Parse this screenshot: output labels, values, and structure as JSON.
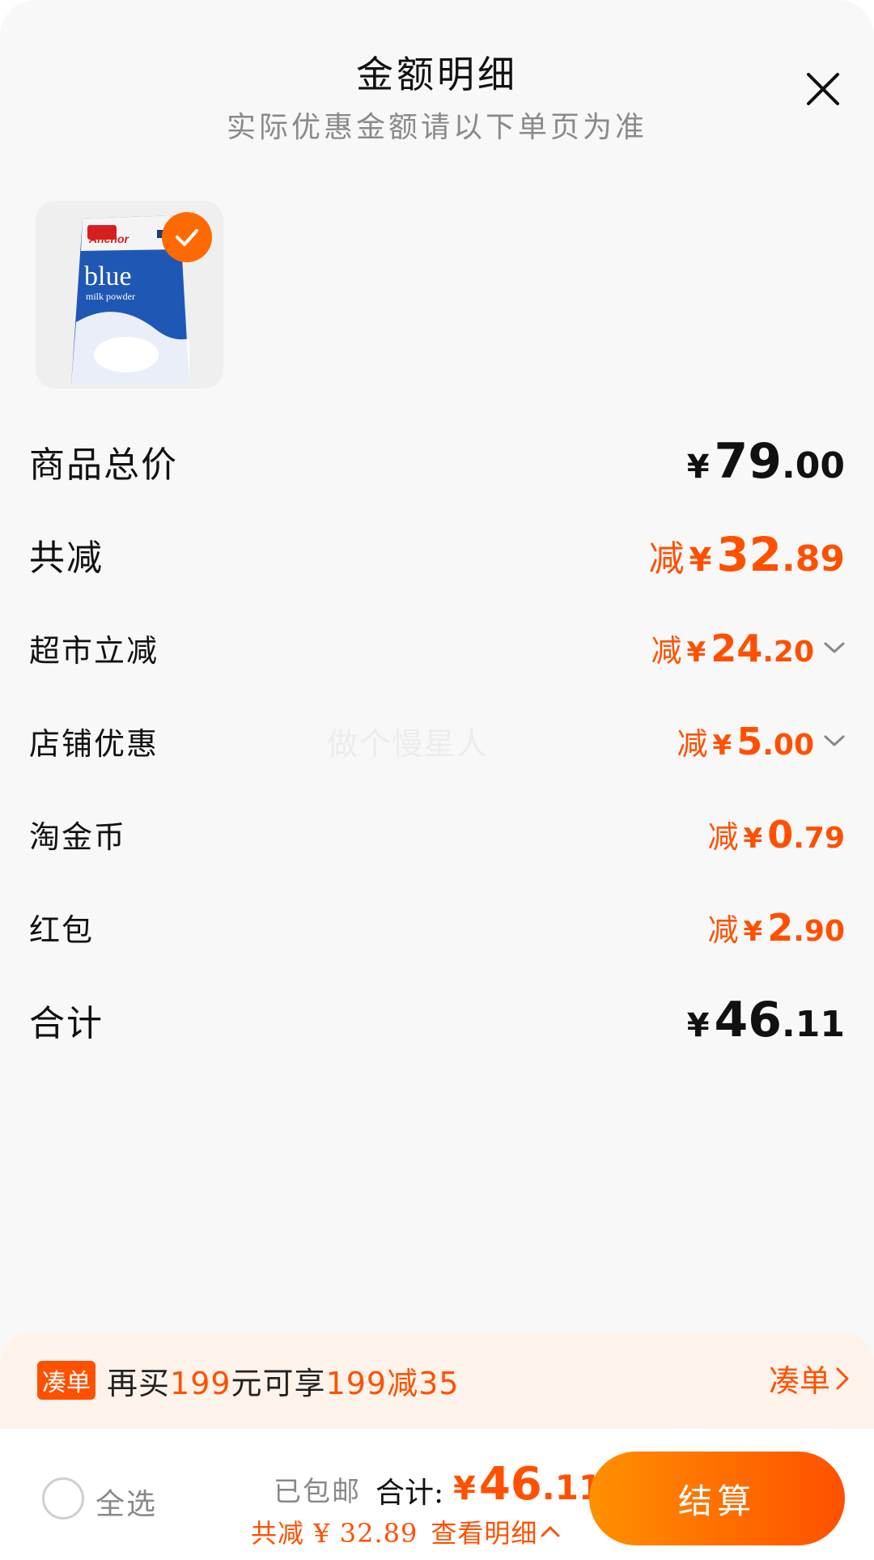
{
  "header": {
    "title": "金额明细",
    "subtitle": "实际优惠金额请以下单页为准",
    "close_icon": "close-icon"
  },
  "product": {
    "image_icon": "anchor-blue-milk-powder-package",
    "brand": "Anchor",
    "name": "blue",
    "desc": "milk powder",
    "selected": true
  },
  "rows": {
    "total_price": {
      "label": "商品总价",
      "yen": "¥",
      "int": "79",
      "dec": ".00"
    },
    "total_discount": {
      "label": "共减",
      "prefix": "减",
      "yen": "¥",
      "int": "32",
      "dec": ".89"
    },
    "supermarket": {
      "label": "超市立减",
      "prefix": "减",
      "yen": "¥",
      "int": "24",
      "dec": ".20"
    },
    "store": {
      "label": "店铺优惠",
      "prefix": "减",
      "yen": "¥",
      "int": "5",
      "dec": ".00"
    },
    "coins": {
      "label": "淘金币",
      "prefix": "减",
      "yen": "¥",
      "int": "0",
      "dec": ".79"
    },
    "redpacket": {
      "label": "红包",
      "prefix": "减",
      "yen": "¥",
      "int": "2",
      "dec": ".90"
    },
    "sum": {
      "label": "合计",
      "yen": "¥",
      "int": "46",
      "dec": ".11"
    }
  },
  "watermark": "做个慢星人",
  "promo": {
    "tag": "凑单",
    "text_a": "再买",
    "amount_a": "199",
    "text_b": "元可享",
    "amount_b": "199减35",
    "link": "凑单"
  },
  "bottom": {
    "select_all": "全选",
    "shipping": "已包邮",
    "total_label": "合计:",
    "total_yen": "¥",
    "total_int": "46",
    "total_dec": ".11",
    "saving": "共减 ¥ 32.89",
    "detail_link": "查看明细",
    "checkout": "结算"
  },
  "colors": {
    "accent": "#ff5000",
    "accent_light": "#ff9000",
    "promo_bg": "#fdf3ea"
  }
}
